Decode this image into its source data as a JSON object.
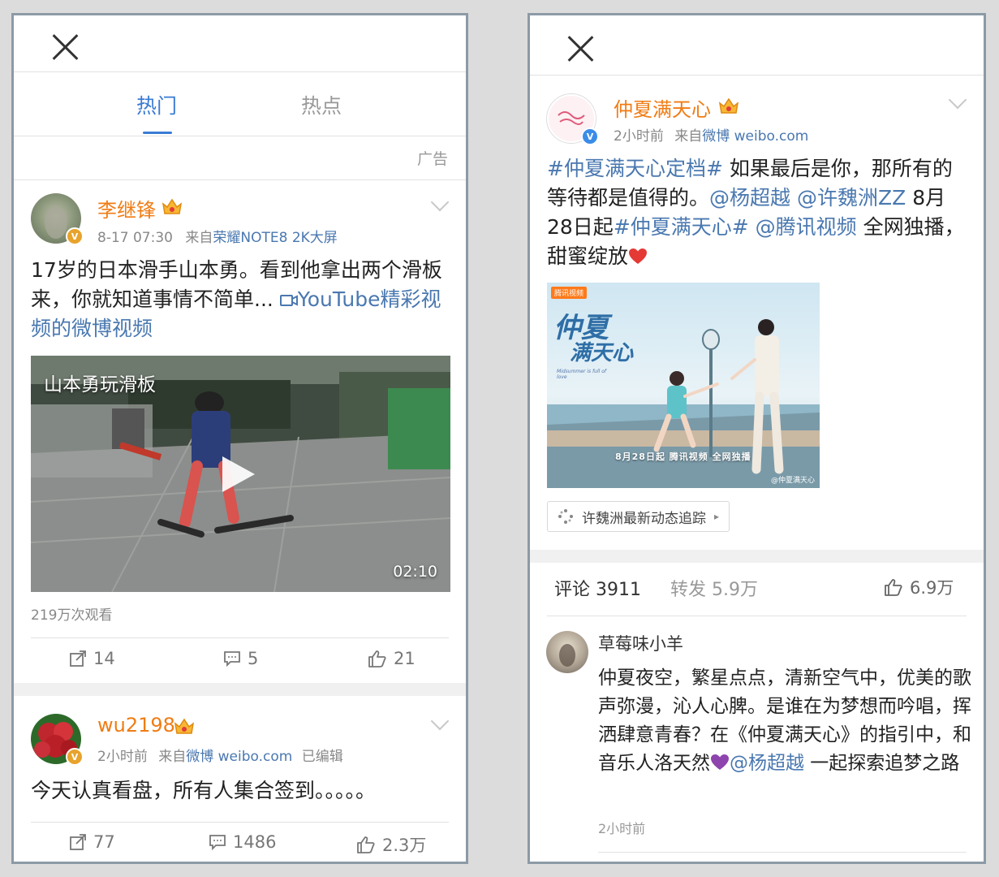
{
  "left": {
    "tabs": [
      {
        "label": "热门"
      },
      {
        "label": "热点"
      }
    ],
    "ad_label": "广告",
    "post1": {
      "username": "李继锋",
      "time": "8-17 07:30",
      "source_prefix": "来自",
      "source": "荣耀NOTE8 2K大屏",
      "text": "17岁的日本滑手山本勇。看到他拿出两个滑板来，你就知道事情不简单... ",
      "link_text": "YouTube精彩视频的微博视频",
      "video": {
        "title": "山本勇玩滑板",
        "duration": "02:10"
      },
      "views": "219万次观看",
      "actions": {
        "repost": "14",
        "comment": "5",
        "like": "21"
      }
    },
    "post2": {
      "username": "wu2198",
      "time": "2小时前",
      "source_prefix": "来自",
      "source": "微博 weibo.com",
      "edited": "已编辑",
      "text": "今天认真看盘，所有人集合签到。。。。。",
      "actions": {
        "repost": "77",
        "comment": "1486",
        "like": "2.3万"
      }
    }
  },
  "right": {
    "post": {
      "username": "仲夏满天心",
      "time": "2小时前",
      "source_prefix": "来自",
      "source": "微博 weibo.com",
      "text_parts": [
        {
          "t": "#仲夏满天心定档#",
          "link": true
        },
        {
          "t": " 如果最后是你，那所有的等待都是值得的。",
          "link": false
        },
        {
          "t": "@杨超越",
          "link": true
        },
        {
          "t": " ",
          "link": false
        },
        {
          "t": "@许魏洲ZZ",
          "link": true
        },
        {
          "t": " 8月28日起",
          "link": false
        },
        {
          "t": "#仲夏满天心#",
          "link": true
        },
        {
          "t": " ",
          "link": false
        },
        {
          "t": "@腾讯视频",
          "link": true
        },
        {
          "t": " 全网独播，甜蜜绽放",
          "link": false
        }
      ],
      "poster": {
        "logo": "腾讯视频",
        "title_line1": "仲夏",
        "title_line2": "满天心",
        "subtitle": "Midsummer is full of love",
        "date_line": "8月28日起 腾讯视频 全网独播",
        "watermark": "@仲夏满天心"
      },
      "topic_chip": "许魏洲最新动态追踪"
    },
    "stats": {
      "comments": "评论 3911",
      "reposts": "转发 5.9万",
      "likes": "6.9万"
    },
    "comment": {
      "user": "草莓味小羊",
      "text_before": "仲夏夜空，繁星点点，清新空气中，优美的歌声弥漫，沁人心脾。是谁在为梦想而吟唱，挥洒肆意青春？在《仲夏满天心》的指引中，和音乐人洛天然",
      "mention": "@杨超越",
      "text_after": " 一起探索追梦之路",
      "time": "2小时前"
    }
  }
}
